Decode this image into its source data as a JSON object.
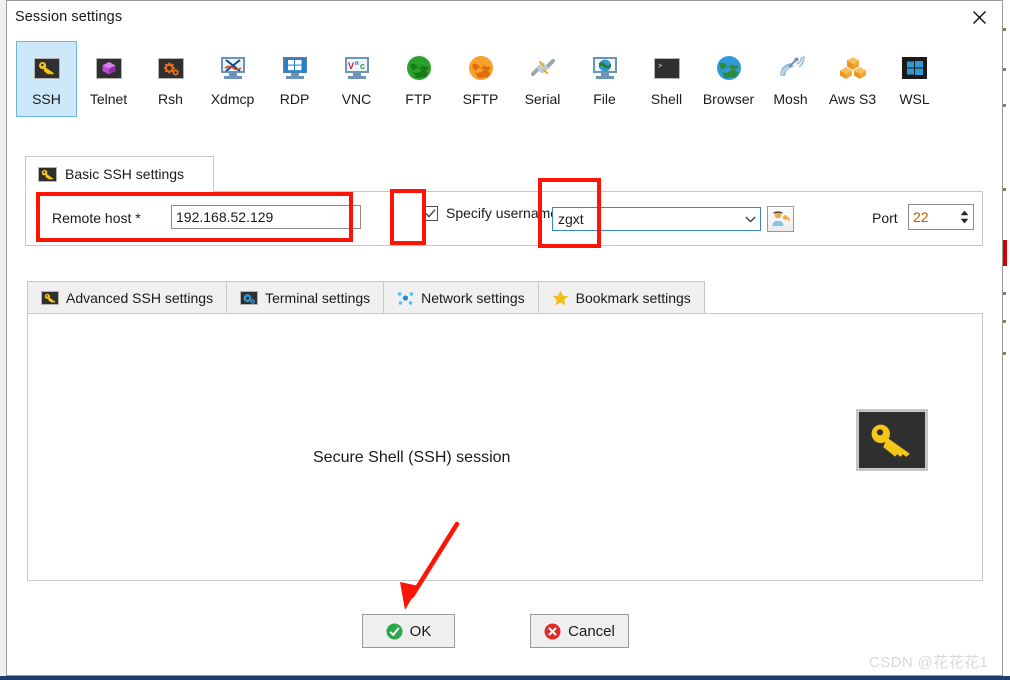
{
  "window": {
    "title": "Session settings",
    "close_icon": "close-icon"
  },
  "protocols": [
    {
      "label": "SSH",
      "icon": "key-icon",
      "selected": true
    },
    {
      "label": "Telnet",
      "icon": "gem-icon",
      "selected": false
    },
    {
      "label": "Rsh",
      "icon": "gears-icon",
      "selected": false
    },
    {
      "label": "Xdmcp",
      "icon": "x-monitor-icon",
      "selected": false
    },
    {
      "label": "RDP",
      "icon": "windows-monitor-icon",
      "selected": false
    },
    {
      "label": "VNC",
      "icon": "vnc-monitor-icon",
      "selected": false
    },
    {
      "label": "FTP",
      "icon": "green-globe-icon",
      "selected": false
    },
    {
      "label": "SFTP",
      "icon": "orange-globe-icon",
      "selected": false
    },
    {
      "label": "Serial",
      "icon": "plug-icon",
      "selected": false
    },
    {
      "label": "File",
      "icon": "file-monitor-icon",
      "selected": false
    },
    {
      "label": "Shell",
      "icon": "terminal-icon",
      "selected": false
    },
    {
      "label": "Browser",
      "icon": "blue-globe-icon",
      "selected": false
    },
    {
      "label": "Mosh",
      "icon": "satellite-icon",
      "selected": false
    },
    {
      "label": "Aws S3",
      "icon": "aws-cubes-icon",
      "selected": false
    },
    {
      "label": "WSL",
      "icon": "windows-icon",
      "selected": false
    }
  ],
  "basic_group": {
    "tab_label": "Basic SSH settings",
    "tab_icon": "key-icon",
    "remote_host_label": "Remote host *",
    "remote_host_value": "192.168.52.129",
    "remote_host_placeholder": "",
    "specify_username_label": "Specify username",
    "specify_username_checked": "checked",
    "username_value": "zgxt",
    "username_placeholder": "",
    "user_browse_icon": "user-key-icon",
    "dropdown_icon": "chevron-down-icon",
    "port_label": "Port",
    "port_value": "22",
    "spinner_up_icon": "spinner-up-icon",
    "spinner_down_icon": "spinner-down-icon"
  },
  "settings_tabs": [
    {
      "label": "Advanced SSH settings",
      "icon": "key-icon",
      "active": true
    },
    {
      "label": "Terminal settings",
      "icon": "gears-icon",
      "active": false
    },
    {
      "label": "Network settings",
      "icon": "network-icon",
      "active": false
    },
    {
      "label": "Bookmark settings",
      "icon": "star-icon",
      "active": false
    }
  ],
  "panel": {
    "session_text": "Secure Shell (SSH) session",
    "badge_icon": "key-icon"
  },
  "buttons": {
    "ok_label": "OK",
    "ok_icon": "green-check-icon",
    "cancel_label": "Cancel",
    "cancel_icon": "red-x-icon"
  },
  "annotations": {
    "highlight_color": "#fc1404",
    "rect_remote_host": "remote-host-highlight",
    "rect_specify_username_checkbox": "specify-username-checkbox-highlight",
    "rect_username_field": "username-field-highlight",
    "arrow_to_ok": "arrow-pointing-to-ok-button"
  },
  "watermark": {
    "text": "CSDN @花花花1"
  }
}
